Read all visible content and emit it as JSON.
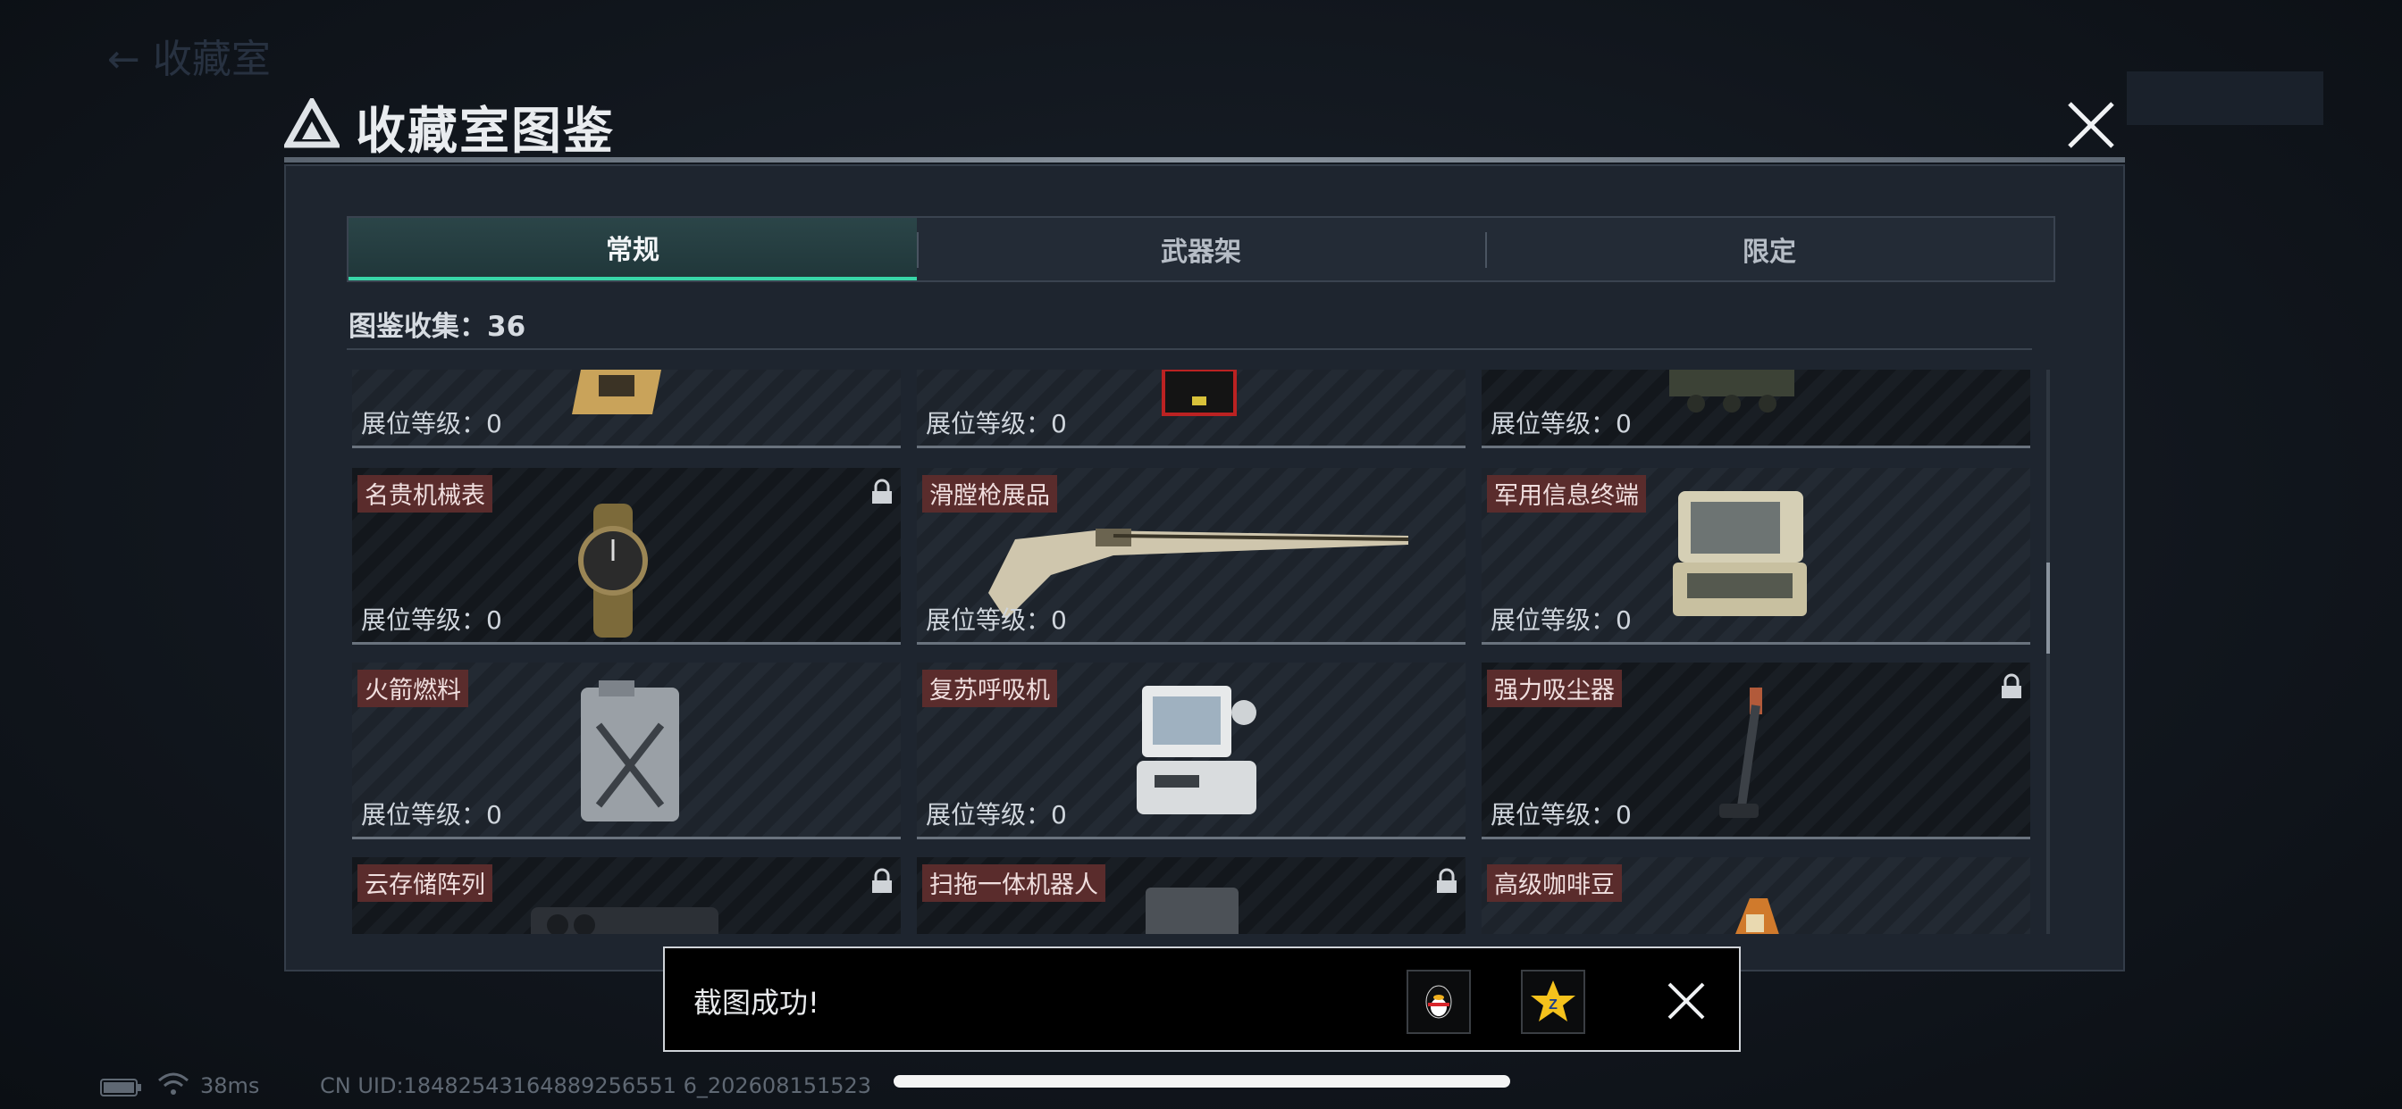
{
  "window": {
    "title": "收藏室图鉴",
    "background_back_label": "← 收藏室"
  },
  "tabs": [
    {
      "label": "常规",
      "active": true
    },
    {
      "label": "武器架",
      "active": false
    },
    {
      "label": "限定",
      "active": false
    }
  ],
  "collection": {
    "label": "图鉴收集：36"
  },
  "items": [
    {
      "name": "",
      "level": "展位等级：0",
      "locked": false
    },
    {
      "name": "",
      "level": "展位等级：0",
      "locked": false
    },
    {
      "name": "",
      "level": "展位等级：0",
      "locked": false
    },
    {
      "name": "名贵机械表",
      "level": "展位等级：0",
      "locked": true
    },
    {
      "name": "滑膛枪展品",
      "level": "展位等级：0",
      "locked": false
    },
    {
      "name": "军用信息终端",
      "level": "展位等级：0",
      "locked": false
    },
    {
      "name": "火箭燃料",
      "level": "展位等级：0",
      "locked": false
    },
    {
      "name": "复苏呼吸机",
      "level": "展位等级：0",
      "locked": false
    },
    {
      "name": "强力吸尘器",
      "level": "展位等级：0",
      "locked": true
    },
    {
      "name": "云存储阵列",
      "level": "",
      "locked": true
    },
    {
      "name": "扫拖一体机器人",
      "level": "",
      "locked": true
    },
    {
      "name": "高级咖啡豆",
      "level": "",
      "locked": false
    }
  ],
  "toast": {
    "message": "截图成功!",
    "share_icons": [
      "qq-penguin-icon",
      "qzone-star-icon"
    ]
  },
  "status_bar": {
    "ping": "38ms",
    "uid": "CN UID:18482543164889256551 6_202608151523"
  },
  "colors": {
    "accent": "#38d6a8",
    "name_tag": "#5a2c2c",
    "panel": "#1e252f"
  }
}
